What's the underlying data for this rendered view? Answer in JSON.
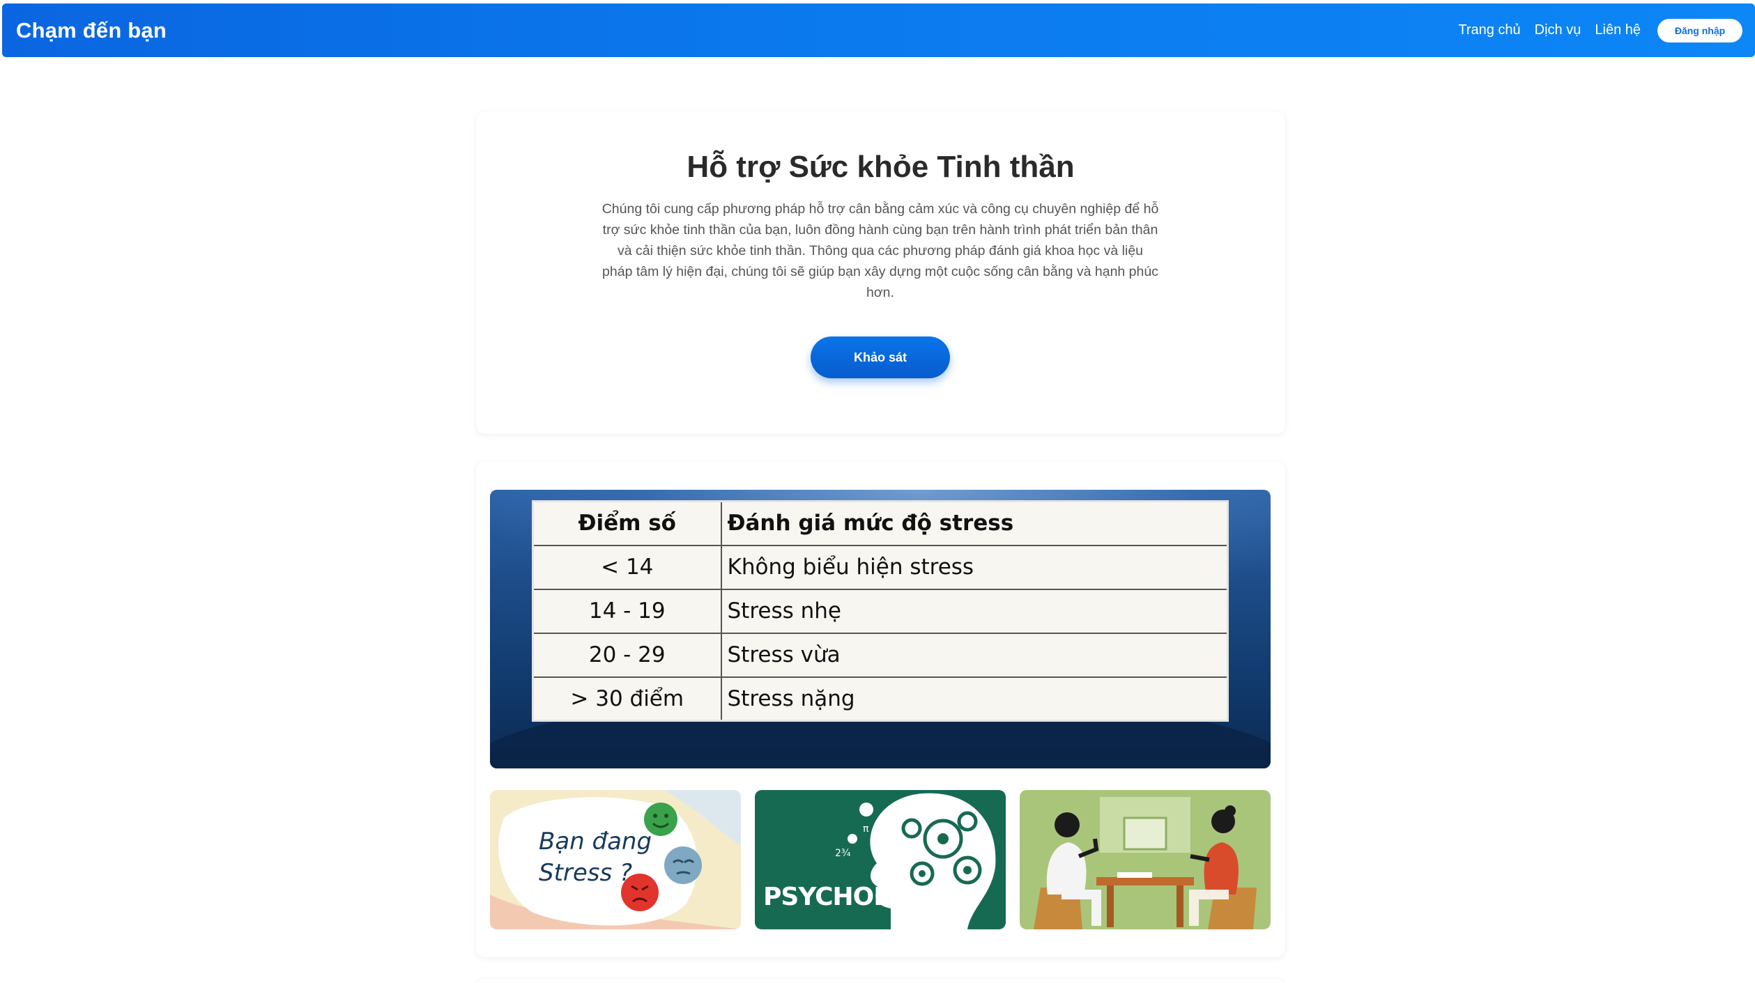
{
  "navbar": {
    "brand": "Chạm đến bạn",
    "links": [
      "Trang chủ",
      "Dịch vụ",
      "Liên hệ"
    ],
    "login_label": "Đăng nhập",
    "gradient_colors": [
      "#0a66e0",
      "#0d86f6"
    ]
  },
  "hero": {
    "title": "Hỗ trợ Sức khỏe Tinh thần",
    "description": "Chúng tôi cung cấp phương pháp hỗ trợ cân bằng cảm xúc và công cụ chuyên nghiệp để hỗ trợ sức khỏe tinh thần của bạn, luôn đồng hành cùng bạn trên hành trình phát triển bản thân và cải thiện sức khỏe tinh thần. Thông qua các phương pháp đánh giá khoa học và liệu pháp tâm lý hiện đại, chúng tôi sẽ giúp bạn xây dựng một cuộc sống cân bằng và hạnh phúc hơn.",
    "cta_label": "Khảo sát"
  },
  "stress_table": {
    "headers": [
      "Điểm số",
      "Đánh giá mức độ stress"
    ],
    "rows": [
      [
        "< 14",
        "Không biểu hiện stress"
      ],
      [
        "14 - 19",
        "Stress nhẹ"
      ],
      [
        "20 - 29",
        "Stress vừa"
      ],
      [
        "> 30 điểm",
        "Stress nặng"
      ]
    ]
  },
  "thumbnails": [
    {
      "icon": "stress-emoji-illustration",
      "text_line1": "Bạn đang",
      "text_line2": "Stress ?"
    },
    {
      "icon": "psychology-head-gears-illustration",
      "text": "PSYCHOLOGY"
    },
    {
      "icon": "therapy-session-illustration"
    }
  ]
}
